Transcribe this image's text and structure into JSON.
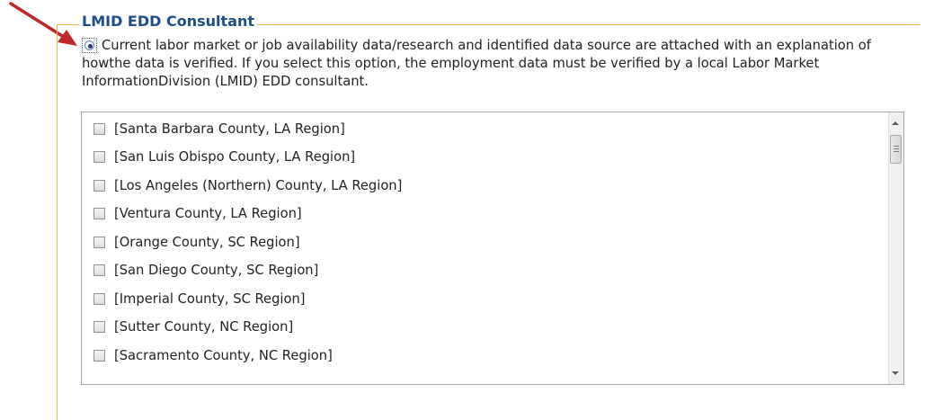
{
  "section": {
    "title": "LMID EDD Consultant",
    "radio_selected": true,
    "description": "Current labor market or job availability data/research and identified data source are attached with an explanation of howthe data is verified. If you select this option, the employment data must be verified by a local Labor Market InformationDivision (LMID) EDD consultant."
  },
  "county_list": {
    "items": [
      {
        "label": "[Santa Barbara County, LA Region]",
        "checked": false
      },
      {
        "label": "[San Luis Obispo County, LA Region]",
        "checked": false
      },
      {
        "label": "[Los Angeles (Northern) County, LA Region]",
        "checked": false
      },
      {
        "label": "[Ventura County, LA Region]",
        "checked": false
      },
      {
        "label": "[Orange County, SC Region]",
        "checked": false
      },
      {
        "label": "[San Diego County, SC Region]",
        "checked": false
      },
      {
        "label": "[Imperial County, SC Region]",
        "checked": false
      },
      {
        "label": "[Sutter County, NC Region]",
        "checked": false
      },
      {
        "label": "[Sacramento County, NC Region]",
        "checked": false
      }
    ]
  },
  "annotation": {
    "arrow_color": "#c0262b",
    "icon": "pointer-arrow-icon"
  }
}
